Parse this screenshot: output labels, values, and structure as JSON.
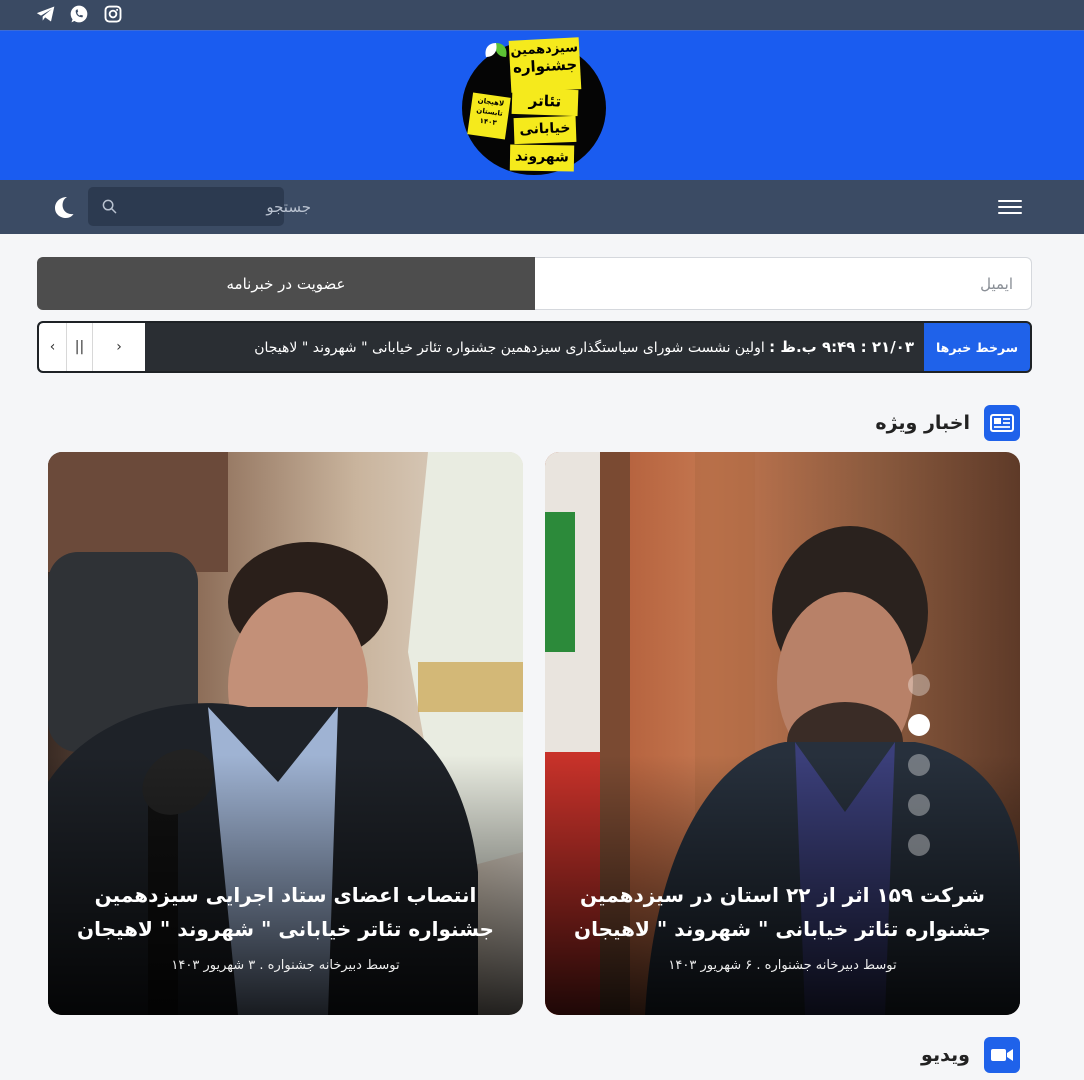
{
  "topbar": {
    "social": [
      "telegram-icon",
      "whatsapp-icon",
      "instagram-icon"
    ]
  },
  "logo": {
    "line1": "سیزدهمین",
    "line2": "جشنواره",
    "line3": "تئاتر",
    "line4": "خیابانی",
    "line5": "شهروند",
    "city": "لاهیجان",
    "season": "تابستان",
    "year": "۱۴۰۳"
  },
  "navbar": {
    "search_placeholder": "جستجو",
    "theme_icon": "moon-icon",
    "menu_icon": "hamburger-icon"
  },
  "newsletter": {
    "email_placeholder": "ایمیل",
    "button_label": "عضویت در خبرنامه"
  },
  "ticker": {
    "badge": "سرخط خبرها",
    "time": "۲۱/۰۳ : ۹:۴۹ ب.ظ :",
    "headline": "اولین نشست شورای سیاستگذاری سیزدهمین جشنواره تئاتر خیابانی \" شهروند \" لاهیجان",
    "prev": "‹",
    "pause": "||",
    "next": "›"
  },
  "featured": {
    "heading": "اخبار ویژه",
    "cards": [
      {
        "title": "شرکت ۱۵۹ اثر از ۲۲ استان در سیزدهمین جشنواره تئاتر خیابانی \" شهروند \" لاهیجان",
        "meta": "توسط دبیرخانه جشنواره . ۶ شهریور ۱۴۰۳"
      },
      {
        "title": "انتصاب اعضای ستاد اجرایی سیزدهمین جشنواره تئاتر خیابانی \" شهروند \" لاهیجان",
        "meta": "توسط دبیرخانه جشنواره . ۳ شهریور ۱۴۰۳"
      }
    ],
    "slider_dots": 5,
    "active_dot": 2
  },
  "video": {
    "heading": "ویدیو"
  },
  "colors": {
    "brand_blue": "#1a5cf0",
    "navbar": "#3b4b64",
    "accent": "#1f62ea"
  }
}
